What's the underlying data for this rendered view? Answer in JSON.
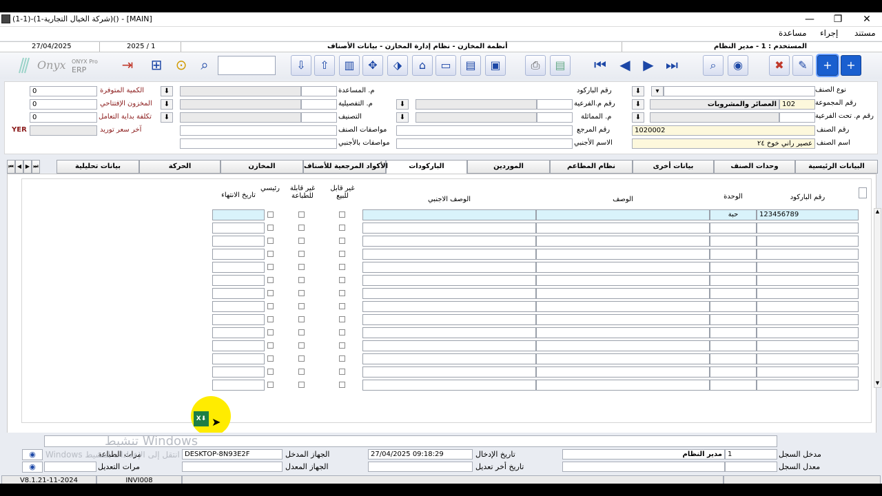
{
  "window": {
    "title": "(1-1)-(1-شركة الخيال التجارية)() - [MAIN]",
    "minimize": "—",
    "restore": "❐",
    "close": "✕"
  },
  "menu": {
    "items": [
      "مستند",
      "إجراء",
      "مساعدة"
    ]
  },
  "strip": {
    "date": "27/04/2025",
    "period": "2025 / 1",
    "system": "أنظمة المخازن - نظام إدارة المخازن - بيانات الأصناف",
    "user": "المستخدم : 1 - مدير النظام"
  },
  "toolbar": {
    "logo_brand": "ONYX Pro",
    "logo_erp": "ERP",
    "logo_swoosh": "Onyx"
  },
  "header": {
    "labels": {
      "item_type": "نوع الصنف",
      "barcode_no": "رقم الباركود",
      "group_no": "رقم المجموعة",
      "sub_no": "رقم م.الفرعية",
      "subsub_no": "رقم م. تحت الفرعية",
      "similar": "م. المماثلة",
      "item_no": "رقم الصنف",
      "ref_no": "رقم المرجع",
      "item_name": "اسم الصنف",
      "foreign_name": "الاسم الأجنبي",
      "helper": "م. المساعدة",
      "detail": "م. التفصيلية",
      "classification": "التصنيف",
      "item_specs": "مواصفات الصنف",
      "foreign_specs": "مواصفات بالأجنبي",
      "qty_available": "الكمية المتوفرة",
      "opening_stock": "المخزون الإفتتاحي",
      "start_cost": "تكلفة بداية التعامل",
      "last_price": "آخر سعر توريد"
    },
    "values": {
      "group_code": "102",
      "group_name": "العصائر والمشروبات",
      "item_no": "1020002",
      "item_name": "عصير راني خوخ ٢٤",
      "qty_available": "0",
      "opening_stock": "0",
      "start_cost": "0",
      "currency": "YER"
    }
  },
  "tabs": [
    "البيانات الرئيسية",
    "وحدات الصنف",
    "بيانات أخرى",
    "نظام المطاعم",
    "الموردين",
    "الباركودات",
    "الأكواد المرجعية للأصناف",
    "المخازن",
    "الحركة",
    "بيانات تحليلية"
  ],
  "grid": {
    "headers": {
      "barcode": "رقم الباركود",
      "unit": "الوحدة",
      "desc": "الوصف",
      "foreign_desc": "الوصف الاجنبي",
      "not_sellable": "غير قابل للبيع",
      "not_printable": "غير قابلة للطباعة",
      "main": "رئيسي",
      "end_date": "تاريخ الانتهاء"
    },
    "first_row": {
      "barcode": "123456789",
      "unit": "حبة"
    }
  },
  "footer": {
    "labels": {
      "entered_by": "مدخل السجل",
      "modified_by": "معدل السجل",
      "entry_date": "تاريخ الإدخال",
      "last_modified": "تاريخ أخر تعديل",
      "entry_device": "الجهاز المدخل",
      "modify_device": "الجهاز المعدل",
      "print_count": "مرات الطباعة",
      "modify_count": "مرات التعديل"
    },
    "values": {
      "entered_by_id": "1",
      "entered_by_name": "مدير النظام",
      "entry_date": "27/04/2025 09:18:29",
      "entry_device": "DESKTOP-8N93E2F"
    },
    "version": "V8.1.21-11-2024",
    "screen_code": "INVI008",
    "watermark1": "تنشيط Windows",
    "watermark2": "Windows انتقل إلى الإعدادات لتنشيط"
  },
  "colors": {
    "selected_blue": "#1a5fcf",
    "highlight_cell": "#d9f3fb",
    "field_yellow": "#fdf8dc",
    "cursor_yellow": "#ffec00"
  }
}
